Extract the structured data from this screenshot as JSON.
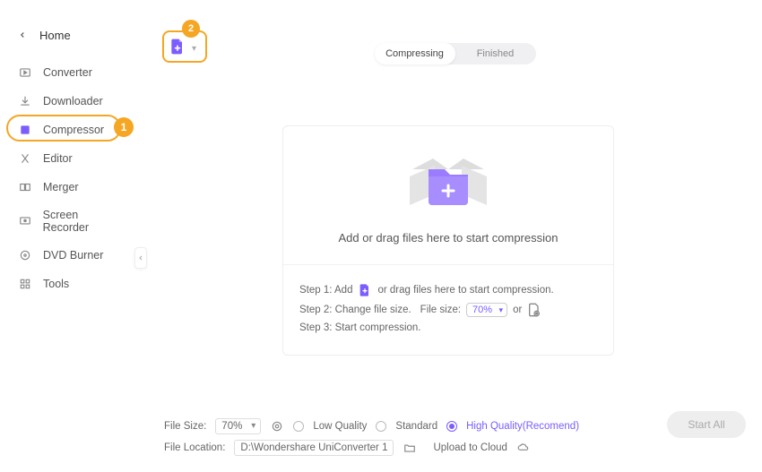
{
  "callouts": {
    "one": "1",
    "two": "2"
  },
  "titlebar": {
    "min": "—",
    "max": "☐",
    "close": "✕"
  },
  "sidebar": {
    "home": "Home",
    "items": [
      {
        "label": "Converter"
      },
      {
        "label": "Downloader"
      },
      {
        "label": "Compressor"
      },
      {
        "label": "Editor"
      },
      {
        "label": "Merger"
      },
      {
        "label": "Screen Recorder"
      },
      {
        "label": "DVD Burner"
      },
      {
        "label": "Tools"
      }
    ]
  },
  "tabs": {
    "compressing": "Compressing",
    "finished": "Finished"
  },
  "drop": {
    "title": "Add or drag files here to start compression",
    "step1_a": "Step 1: Add",
    "step1_b": "or drag files here to start compression.",
    "step2_a": "Step 2: Change file size.",
    "step2_filesize_label": "File size:",
    "step2_pct": "70%",
    "step2_or": "or",
    "step3": "Step 3: Start compression."
  },
  "bottom": {
    "filesize_label": "File Size:",
    "filesize_value": "70%",
    "quality": {
      "low": "Low Quality",
      "standard": "Standard",
      "high": "High Quality(Recomend)"
    },
    "location_label": "File Location:",
    "location_value": "D:\\Wondershare UniConverter 1",
    "upload": "Upload to Cloud",
    "start": "Start All"
  }
}
